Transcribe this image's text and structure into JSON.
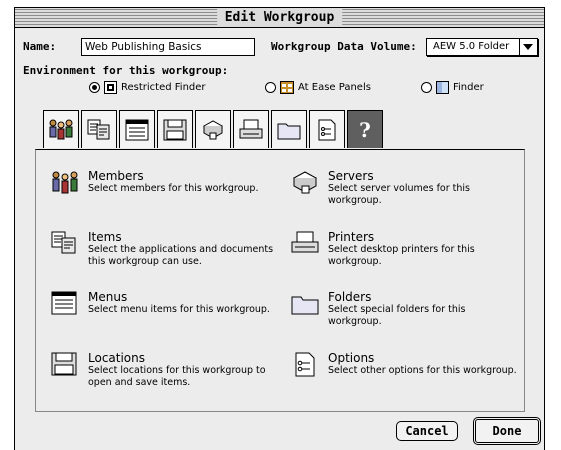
{
  "window": {
    "title": "Edit Workgroup"
  },
  "name_label": "Name:",
  "name_value": "Web Publishing Basics",
  "volume_label": "Workgroup Data Volume:",
  "volume_value": "AEW 5.0 Folder",
  "env_label": "Environment for this workgroup:",
  "radios": [
    {
      "label": "Restricted Finder",
      "selected": true,
      "icon": "restricted-finder-icon"
    },
    {
      "label": "At Ease Panels",
      "selected": false,
      "icon": "at-ease-panels-icon"
    },
    {
      "label": "Finder",
      "selected": false,
      "icon": "finder-icon"
    }
  ],
  "tabs": [
    {
      "icon": "members-icon"
    },
    {
      "icon": "items-icon"
    },
    {
      "icon": "menus-icon"
    },
    {
      "icon": "locations-icon"
    },
    {
      "icon": "servers-icon"
    },
    {
      "icon": "printers-icon"
    },
    {
      "icon": "folders-icon"
    },
    {
      "icon": "options-icon"
    },
    {
      "icon": "help-icon",
      "label": "?"
    }
  ],
  "items": [
    {
      "title": "Members",
      "desc": "Select members for this workgroup.",
      "icon": "members-icon"
    },
    {
      "title": "Servers",
      "desc": "Select server volumes for this workgroup.",
      "icon": "servers-icon"
    },
    {
      "title": "Items",
      "desc": "Select the applications and documents this workgroup can use.",
      "icon": "items-icon"
    },
    {
      "title": "Printers",
      "desc": "Select desktop printers for this workgroup.",
      "icon": "printers-icon"
    },
    {
      "title": "Menus",
      "desc": "Select menu items for this workgroup.",
      "icon": "menus-icon"
    },
    {
      "title": "Folders",
      "desc": "Select special folders for this workgroup.",
      "icon": "folders-icon"
    },
    {
      "title": "Locations",
      "desc": "Select locations for this workgroup to open and save items.",
      "icon": "locations-icon"
    },
    {
      "title": "Options",
      "desc": "Select other options for this workgroup.",
      "icon": "options-icon"
    }
  ],
  "buttons": {
    "cancel": "Cancel",
    "done": "Done"
  }
}
